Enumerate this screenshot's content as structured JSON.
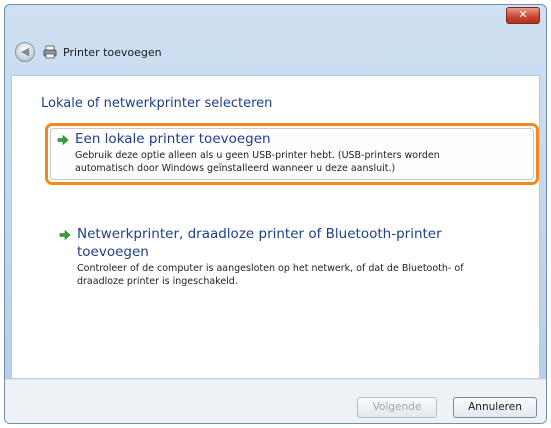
{
  "window": {
    "close_label": "✕",
    "title": "Printer toevoegen"
  },
  "content": {
    "heading": "Lokale of netwerkprinter selecteren",
    "options": [
      {
        "title": "Een lokale printer toevoegen",
        "description_line1": "Gebruik deze optie alleen als u geen USB-printer hebt. (USB-printers worden",
        "description_line2": "automatisch door Windows geïnstalleerd wanneer u deze aansluit.)"
      },
      {
        "title_line1": "Netwerkprinter, draadloze printer of Bluetooth-printer",
        "title_line2": "toevoegen",
        "description_line1": "Controleer of de computer is aangesloten op het netwerk, of dat de Bluetooth- of",
        "description_line2": "draadloze printer is ingeschakeld."
      }
    ]
  },
  "footer": {
    "next_label": "Volgende",
    "cancel_label": "Annuleren"
  },
  "colors": {
    "accent_title": "#1f3f8c",
    "highlight_border": "#f08a1c",
    "arrow_green": "#2fa52f"
  },
  "icons": {
    "back": "back-arrow-icon",
    "printer": "printer-icon",
    "option_arrow": "green-arrow-icon"
  }
}
